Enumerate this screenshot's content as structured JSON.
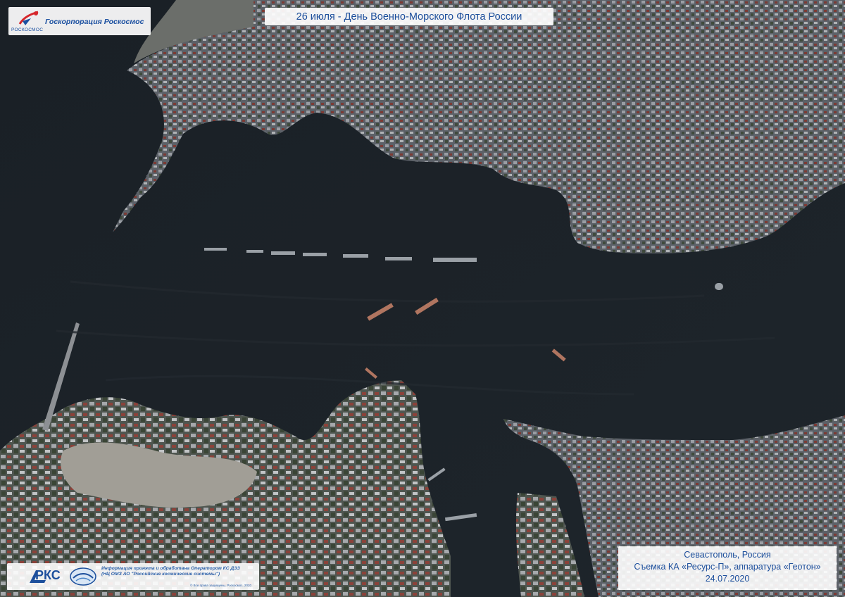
{
  "header": {
    "org_name": "Госкорпорация Роскосмос",
    "logo_word": "РОСКОСМОС",
    "title": "26 июля - День Военно-Морского Флота России"
  },
  "caption": {
    "location": "Севастополь, Россия",
    "source": "Съемка КА «Ресурс-П», аппаратура «Геотон»",
    "date": "24.07.2020"
  },
  "footer": {
    "brand": "РКС",
    "info_line1": "Информация принята и обработана Оператором КС ДЗЗ",
    "info_line2": "(НЦ ОМЗ АО \"Российские космические системы\")",
    "rights": "© Все права защищены. Роскосмос, 2020"
  },
  "colors": {
    "water": "#1b2127",
    "land": "#5b6068",
    "accent_blue": "#1d4f9c"
  }
}
